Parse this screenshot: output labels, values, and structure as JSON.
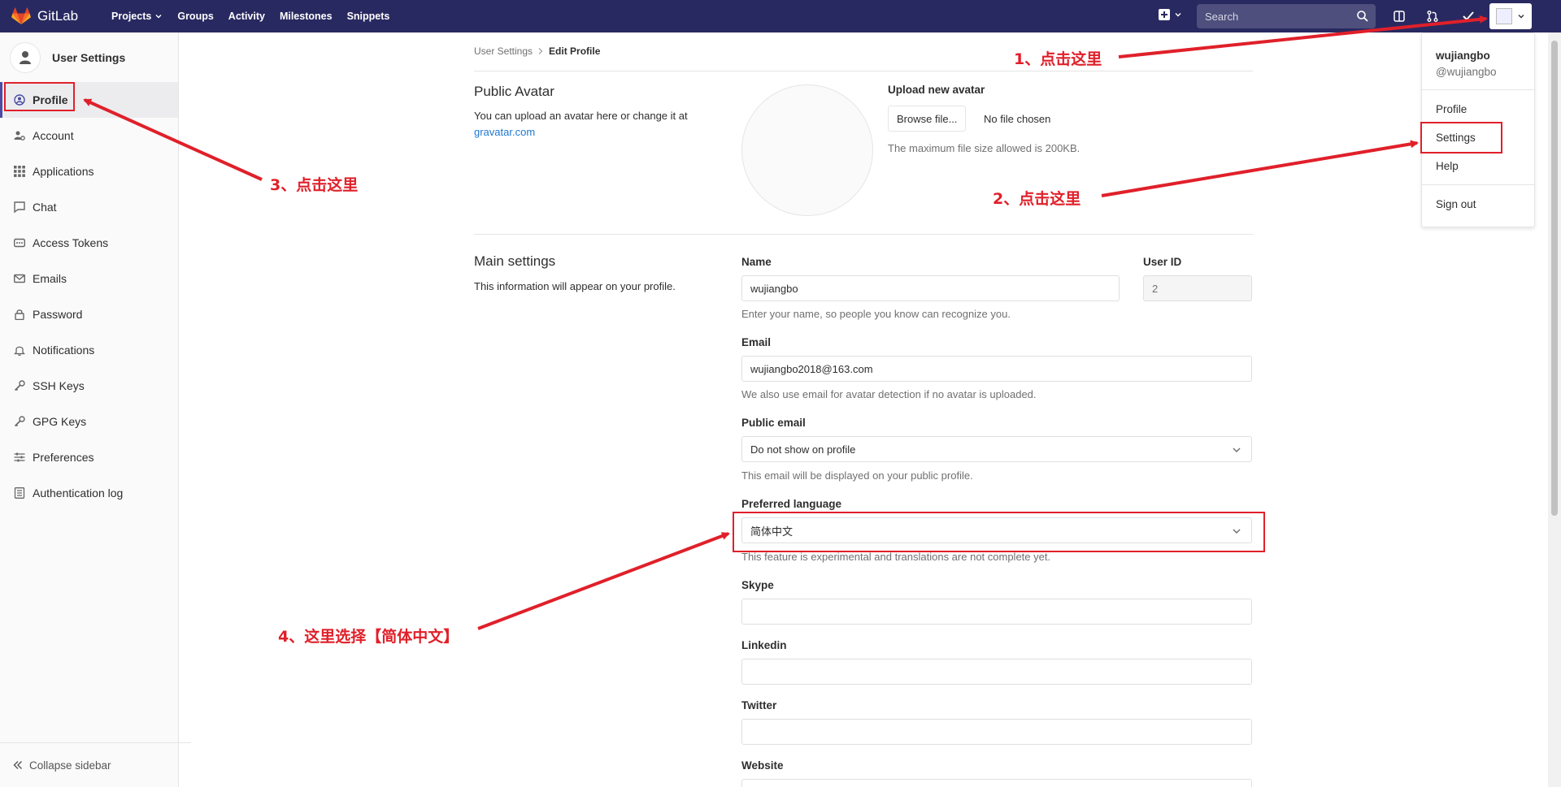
{
  "navbar": {
    "brand": "GitLab",
    "links": [
      "Projects",
      "Groups",
      "Activity",
      "Milestones",
      "Snippets"
    ],
    "search_placeholder": "Search",
    "bg_color": "#292961"
  },
  "dropdown": {
    "name": "wujiangbo",
    "handle": "@wujiangbo",
    "items": [
      "Profile",
      "Settings",
      "Help",
      "Sign out"
    ]
  },
  "sidebar": {
    "title": "User Settings",
    "items": [
      {
        "label": "Profile",
        "icon": "profile-icon"
      },
      {
        "label": "Account",
        "icon": "account-icon"
      },
      {
        "label": "Applications",
        "icon": "applications-icon"
      },
      {
        "label": "Chat",
        "icon": "chat-icon"
      },
      {
        "label": "Access Tokens",
        "icon": "token-icon"
      },
      {
        "label": "Emails",
        "icon": "mail-icon"
      },
      {
        "label": "Password",
        "icon": "lock-icon"
      },
      {
        "label": "Notifications",
        "icon": "bell-icon"
      },
      {
        "label": "SSH Keys",
        "icon": "key-icon"
      },
      {
        "label": "GPG Keys",
        "icon": "key-icon"
      },
      {
        "label": "Preferences",
        "icon": "sliders-icon"
      },
      {
        "label": "Authentication log",
        "icon": "log-icon"
      }
    ],
    "collapse": "Collapse sidebar"
  },
  "breadcrumb": {
    "parent": "User Settings",
    "current": "Edit Profile"
  },
  "avatar_section": {
    "title": "Public Avatar",
    "desc": "You can upload an avatar here or change it at",
    "link": "gravatar.com",
    "upload_label": "Upload new avatar",
    "browse": "Browse file...",
    "no_file": "No file chosen",
    "max_size": "The maximum file size allowed is 200KB."
  },
  "main_settings": {
    "title": "Main settings",
    "desc": "This information will appear on your profile.",
    "name_label": "Name",
    "name_value": "wujiangbo",
    "name_help": "Enter your name, so people you know can recognize you.",
    "userid_label": "User ID",
    "userid_value": "2",
    "email_label": "Email",
    "email_value": "wujiangbo2018@163.com",
    "email_help": "We also use email for avatar detection if no avatar is uploaded.",
    "public_email_label": "Public email",
    "public_email_value": "Do not show on profile",
    "public_email_help": "This email will be displayed on your public profile.",
    "language_label": "Preferred language",
    "language_value": "简体中文",
    "language_help": "This feature is experimental and translations are not complete yet.",
    "skype_label": "Skype",
    "linkedin_label": "Linkedin",
    "twitter_label": "Twitter",
    "website_label": "Website"
  },
  "annotations": {
    "step1": "1、点击这里",
    "step2": "2、点击这里",
    "step3": "3、点击这里",
    "step4": "4、这里选择【简体中文】",
    "color": "#e0202a"
  }
}
